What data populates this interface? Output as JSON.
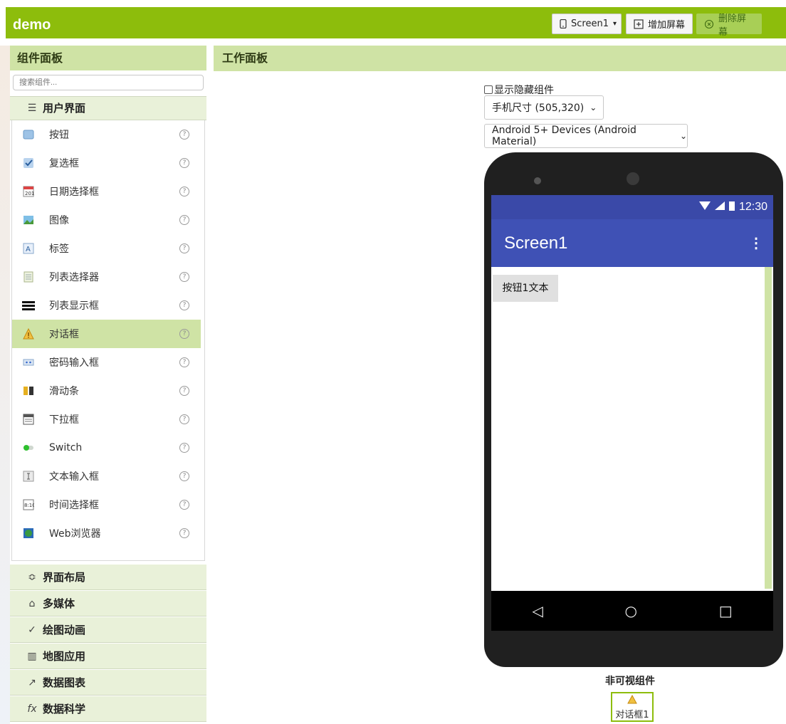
{
  "project": {
    "title": "demo"
  },
  "toolbar": {
    "screen_label": "Screen1",
    "screen_dropdown": "▾",
    "add_screen": "增加屏幕",
    "remove_screen": "删除屏幕"
  },
  "palette": {
    "title": "组件面板",
    "search_placeholder": "搜索组件...",
    "open_category": "用户界面",
    "items": [
      {
        "label": "按钮",
        "icon": "button-icon"
      },
      {
        "label": "复选框",
        "icon": "checkbox-icon"
      },
      {
        "label": "日期选择框",
        "icon": "calendar-icon"
      },
      {
        "label": "图像",
        "icon": "image-icon"
      },
      {
        "label": "标签",
        "icon": "label-icon"
      },
      {
        "label": "列表选择器",
        "icon": "list-picker-icon"
      },
      {
        "label": "列表显示框",
        "icon": "list-view-icon"
      },
      {
        "label": "对话框",
        "icon": "warning-icon",
        "selected": true
      },
      {
        "label": "密码输入框",
        "icon": "password-icon"
      },
      {
        "label": "滑动条",
        "icon": "slider-icon"
      },
      {
        "label": "下拉框",
        "icon": "spinner-icon"
      },
      {
        "label": "Switch",
        "icon": "switch-icon"
      },
      {
        "label": "文本输入框",
        "icon": "textbox-icon"
      },
      {
        "label": "时间选择框",
        "icon": "time-picker-icon"
      },
      {
        "label": "Web浏览器",
        "icon": "web-viewer-icon"
      }
    ],
    "help_glyph": "?",
    "other_categories": [
      {
        "label": "界面布局",
        "glyph": "≎"
      },
      {
        "label": "多媒体",
        "glyph": "⌂"
      },
      {
        "label": "绘图动画",
        "glyph": "✓"
      },
      {
        "label": "地图应用",
        "glyph": "▥"
      },
      {
        "label": "数据图表",
        "glyph": "↗"
      },
      {
        "label": "数据科学",
        "glyph": "fx"
      }
    ]
  },
  "workspace": {
    "title": "工作面板",
    "show_hidden": "显示隐藏组件",
    "phone_size": "手机尺寸 (505,320)",
    "theme": "Android 5+ Devices (Android Material)",
    "status_time": "12:30",
    "screen_title": "Screen1",
    "overflow_menu": "⋮",
    "button_text": "按钮1文本",
    "nav_back": "◁",
    "nav_home": "○",
    "nav_recent": "□",
    "nonvisible_title": "非可视组件",
    "nonvisible_item": "对话框1"
  }
}
